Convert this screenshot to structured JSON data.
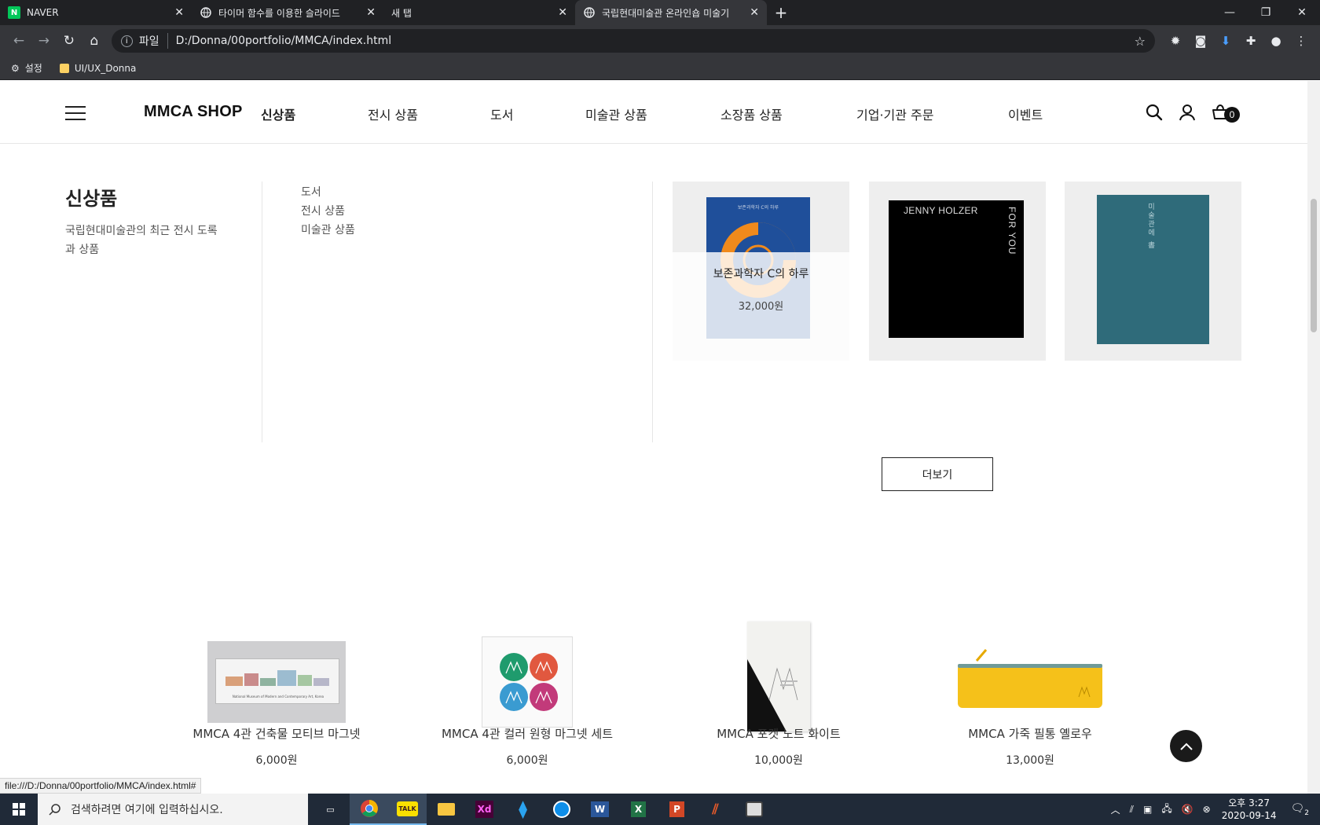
{
  "browser": {
    "tabs": [
      {
        "title": "NAVER",
        "icon": "naver-icon",
        "active": false
      },
      {
        "title": "타이머 함수를 이용한 슬라이드",
        "icon": "globe-icon",
        "active": false
      },
      {
        "title": "새 탭",
        "icon": "none",
        "active": false
      },
      {
        "title": "국립현대미술관 온라인숍 미술기",
        "icon": "globe-icon",
        "active": true
      }
    ],
    "new_tab": "+",
    "address": {
      "protocol": "파일",
      "url": "D:/Donna/00portfolio/MMCA/index.html"
    },
    "bookmarks": [
      {
        "label": "설정",
        "icon": "gear-icon"
      },
      {
        "label": "UI/UX_Donna",
        "icon": "folder-icon"
      }
    ]
  },
  "site": {
    "logo": "MMCA SHOP",
    "nav": [
      "신상품",
      "전시 상품",
      "도서",
      "미술관 상품",
      "소장품 상품",
      "기업·기관 주문",
      "이벤트"
    ],
    "cart_count": "0",
    "mega": {
      "title": "신상품",
      "description": "국립현대미술관의 최근 전시 도록과 상품",
      "submenu": [
        "도서",
        "전시 상품",
        "미술관 상품"
      ],
      "cards": [
        {
          "name": "보존과학자 C의 하루",
          "price": "32,000원",
          "book_title": "보존과학자 C의 하루",
          "hovered": true,
          "cover_color": "#1f4f9a"
        },
        {
          "name": "",
          "price": "",
          "book_title": "JENNY HOLZER",
          "side_text": "FOR YOU",
          "cover_color": "#000000"
        },
        {
          "name": "",
          "price": "",
          "book_title": "미술관에 書",
          "cover_color": "#2f6b7a"
        }
      ],
      "more_button": "더보기"
    },
    "products": [
      {
        "name": "MMCA 4관 건축물 모티브 마그넷",
        "price": "6,000원",
        "caption": "National Museum of Modern and Contemporary Art, Korea"
      },
      {
        "name": "MMCA 4관 컬러 원형 마그넷 세트",
        "price": "6,000원"
      },
      {
        "name": "MMCA 포켓 노트 화이트",
        "price": "10,000원"
      },
      {
        "name": "MMCA 가죽 필통 옐로우",
        "price": "13,000원"
      }
    ]
  },
  "status_bar": {
    "url": "file:///D:/Donna/00portfolio/MMCA/index.html#"
  },
  "taskbar": {
    "search_placeholder": "검색하려면 여기에 입력하십시오.",
    "apps": [
      "task-view",
      "chrome",
      "kakaotalk",
      "file-explorer",
      "adobe-xd",
      "vscode",
      "teamviewer",
      "word",
      "excel",
      "powerpoint",
      "winrar",
      "app"
    ],
    "app_labels": {
      "kakaotalk": "TALK",
      "adobe-xd": "Xd",
      "word": "W",
      "excel": "X",
      "powerpoint": "P"
    },
    "clock": {
      "time": "오후 3:27",
      "date": "2020-09-14"
    },
    "notification_count": "2"
  }
}
